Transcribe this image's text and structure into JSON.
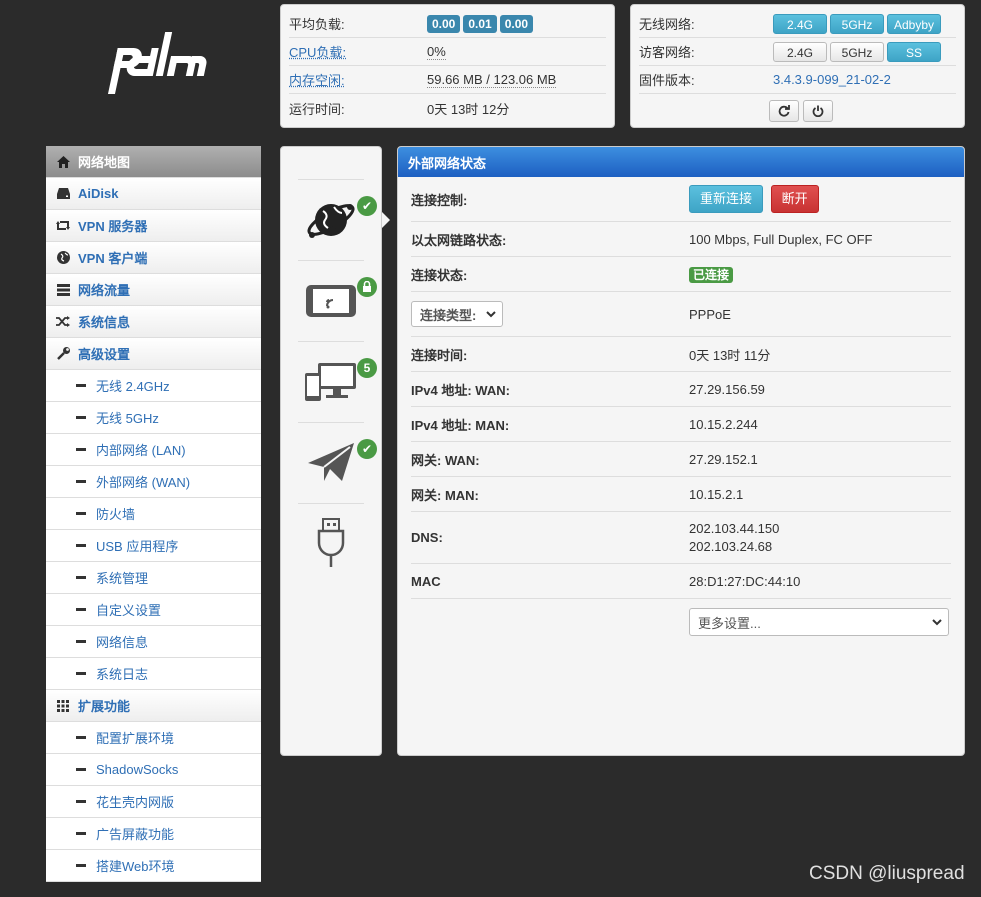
{
  "logo": {
    "text": "pdcn"
  },
  "sysinfo": {
    "rows": [
      {
        "label": "平均负载:",
        "badges": [
          "0.00",
          "0.01",
          "0.00"
        ]
      },
      {
        "label": "CPU负载:",
        "value": "0%"
      },
      {
        "label": "内存空闲:",
        "value": "59.66 MB / 123.06 MB"
      },
      {
        "label": "运行时间:",
        "value": "0天 13时 12分"
      }
    ]
  },
  "network": {
    "wireless_label": "无线网络:",
    "wireless_buttons": [
      "2.4G",
      "5GHz",
      "Adbyby"
    ],
    "guest_label": "访客网络:",
    "guest_buttons": [
      "2.4G",
      "5GHz",
      "SS"
    ],
    "firmware_label": "固件版本:",
    "firmware_value": "3.4.3.9-099_21-02-2",
    "icons": [
      "refresh-icon",
      "power-icon"
    ]
  },
  "sidebar": {
    "items": [
      {
        "label": "网络地图",
        "icon": "home-icon"
      },
      {
        "label": "AiDisk",
        "icon": "disk-icon"
      },
      {
        "label": "VPN 服务器",
        "icon": "retweet-icon"
      },
      {
        "label": "VPN 客户端",
        "icon": "globe-icon"
      },
      {
        "label": "网络流量",
        "icon": "tasks-icon"
      },
      {
        "label": "系统信息",
        "icon": "random-icon"
      },
      {
        "label": "高级设置",
        "icon": "wrench-icon"
      },
      {
        "label": "无线 2.4GHz"
      },
      {
        "label": "无线 5GHz"
      },
      {
        "label": "内部网络 (LAN)"
      },
      {
        "label": "外部网络 (WAN)"
      },
      {
        "label": "防火墙"
      },
      {
        "label": "USB 应用程序"
      },
      {
        "label": "系统管理"
      },
      {
        "label": "自定义设置"
      },
      {
        "label": "网络信息"
      },
      {
        "label": "系统日志"
      },
      {
        "label": "扩展功能",
        "icon": "grid-icon"
      },
      {
        "label": "配置扩展环境"
      },
      {
        "label": "ShadowSocks"
      },
      {
        "label": "花生壳内网版"
      },
      {
        "label": "广告屏蔽功能"
      },
      {
        "label": "搭建Web环境"
      }
    ]
  },
  "iconcol": {
    "badge_count": "5"
  },
  "main": {
    "title": "外部网络状态",
    "reconnect": "重新连接",
    "disconnect": "断开",
    "rows": {
      "control": "连接控制:",
      "eth_label": "以太网链路状态:",
      "eth_value": "100 Mbps, Full Duplex, FC OFF",
      "status_label": "连接状态:",
      "status_value": "已连接",
      "type_select": "连接类型:",
      "type_value": "PPPoE",
      "time_label": "连接时间:",
      "time_value": "0天 13时 11分",
      "ipv4_wan_label": "IPv4 地址: WAN:",
      "ipv4_wan_value": "27.29.156.59",
      "ipv4_man_label": "IPv4 地址: MAN:",
      "ipv4_man_value": "10.15.2.244",
      "gw_wan_label": "网关: WAN:",
      "gw_wan_value": "27.29.152.1",
      "gw_man_label": "网关: MAN:",
      "gw_man_value": "10.15.2.1",
      "dns_label": "DNS:",
      "dns_value1": "202.103.44.150",
      "dns_value2": "202.103.24.68",
      "mac_label": "MAC",
      "mac_value": "28:D1:27:DC:44:10",
      "more_select": "更多设置..."
    }
  },
  "watermark": "CSDN @liuspread"
}
